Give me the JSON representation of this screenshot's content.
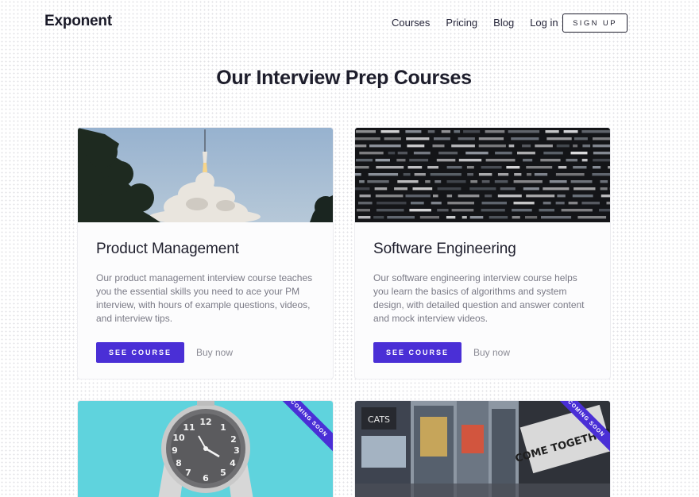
{
  "header": {
    "logo": "Exponent",
    "nav": [
      "Courses",
      "Pricing",
      "Blog",
      "Log in"
    ],
    "signup": "SIGN UP"
  },
  "page": {
    "title": "Our Interview Prep Courses"
  },
  "courses": [
    {
      "title": "Product Management",
      "description": "Our product management interview course teaches you the essential skills you need to ace your PM interview, with hours of example questions, videos, and interview tips.",
      "cta": "SEE COURSE",
      "buy": "Buy now",
      "image": "rocket-launch-photo"
    },
    {
      "title": "Software Engineering",
      "description": "Our software engineering interview course helps you learn the basics of algorithms and system design, with detailed question and answer content and mock interview videos.",
      "cta": "SEE COURSE",
      "buy": "Buy now",
      "image": "code-screen-photo"
    },
    {
      "badge": "COMING SOON",
      "image": "alarm-clock-photo"
    },
    {
      "badge": "COMING SOON",
      "image": "city-billboards-photo",
      "image_text": "CATS"
    }
  ],
  "colors": {
    "accent": "#4a2fd6",
    "clock_bg": "#5fd3dd"
  }
}
